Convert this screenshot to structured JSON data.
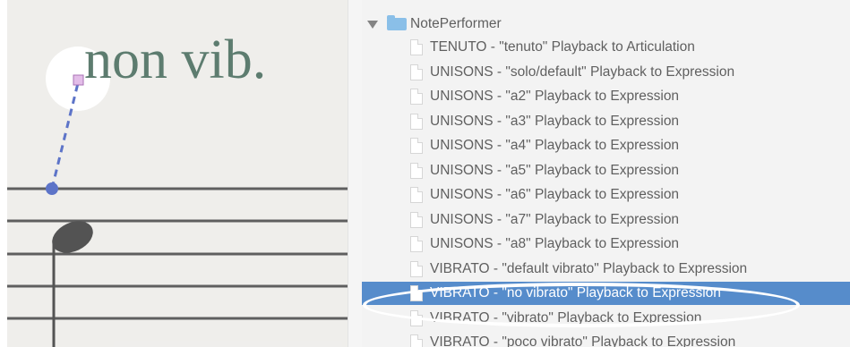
{
  "score": {
    "text": "non vib."
  },
  "panel": {
    "folder": "NotePerformer",
    "items": [
      "TENUTO - \"tenuto\" Playback to Articulation",
      "UNISONS - \"solo/default\" Playback to Expression",
      "UNISONS - \"a2\" Playback to Expression",
      "UNISONS - \"a3\" Playback to Expression",
      "UNISONS - \"a4\" Playback to Expression",
      "UNISONS - \"a5\" Playback to Expression",
      "UNISONS - \"a6\" Playback to Expression",
      "UNISONS - \"a7\" Playback to Expression",
      "UNISONS - \"a8\" Playback to Expression",
      "VIBRATO - \"default vibrato\" Playback to Expression",
      "VIBRATO - \"no vibrato\" Playback to Expression",
      "VIBRATO - \"vibrato\" Playback to Expression",
      "VIBRATO - \"poco vibrato\" Playback to Expression"
    ],
    "selected_index": 10
  },
  "colors": {
    "selection": "#1560b8",
    "score_text": "#1f4a38",
    "anchor_line": "#1f3fb3",
    "folder": "#5ea7e0"
  }
}
